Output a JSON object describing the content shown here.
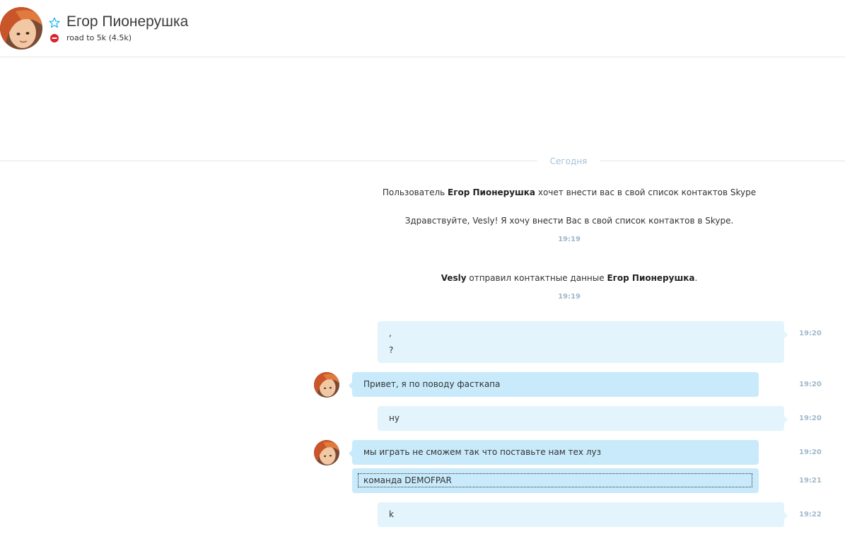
{
  "header": {
    "contact_name": "Егор Пионерушка",
    "mood": "road to 5k (4.5k)",
    "status": "do-not-disturb",
    "icons": {
      "favorite": "star-outline-icon",
      "status": "dnd-status-icon"
    }
  },
  "conversation": {
    "date_label": "Сегодня",
    "system_messages": [
      {
        "prefix": "Пользователь ",
        "bold": "Егор Пионерушка",
        "suffix": " хочет внести вас в свой список контактов Skype"
      },
      {
        "text": "Здравствуйте, Vesly! Я хочу внести Вас в свой список контактов в Skype.",
        "time": "19:19"
      },
      {
        "bold1": "Vesly",
        "middle": " отправил контактные данные ",
        "bold2": "Егор Пионерушка",
        "suffix": ".",
        "time": "19:19"
      }
    ],
    "messages": [
      {
        "direction": "out",
        "lines": [
          ",",
          "?"
        ],
        "time": "19:20"
      },
      {
        "direction": "in",
        "lines": [
          "Привет, я по поводу фасткапа"
        ],
        "time": "19:20"
      },
      {
        "direction": "out",
        "lines": [
          "ну"
        ],
        "time": "19:20"
      },
      {
        "direction": "in",
        "lines": [
          "мы играть не сможем так что поставьте нам тех луз"
        ],
        "time": "19:20"
      },
      {
        "direction": "in",
        "lines": [
          "команда DEMOFPAR"
        ],
        "time": "19:21"
      },
      {
        "direction": "out",
        "lines": [
          "k"
        ],
        "time": "19:22"
      }
    ]
  },
  "colors": {
    "bubble_outgoing": "#e3f4fc",
    "bubble_incoming": "#c8eafa",
    "timestamp": "#9fb9ca",
    "status_dnd": "#d9232e"
  }
}
